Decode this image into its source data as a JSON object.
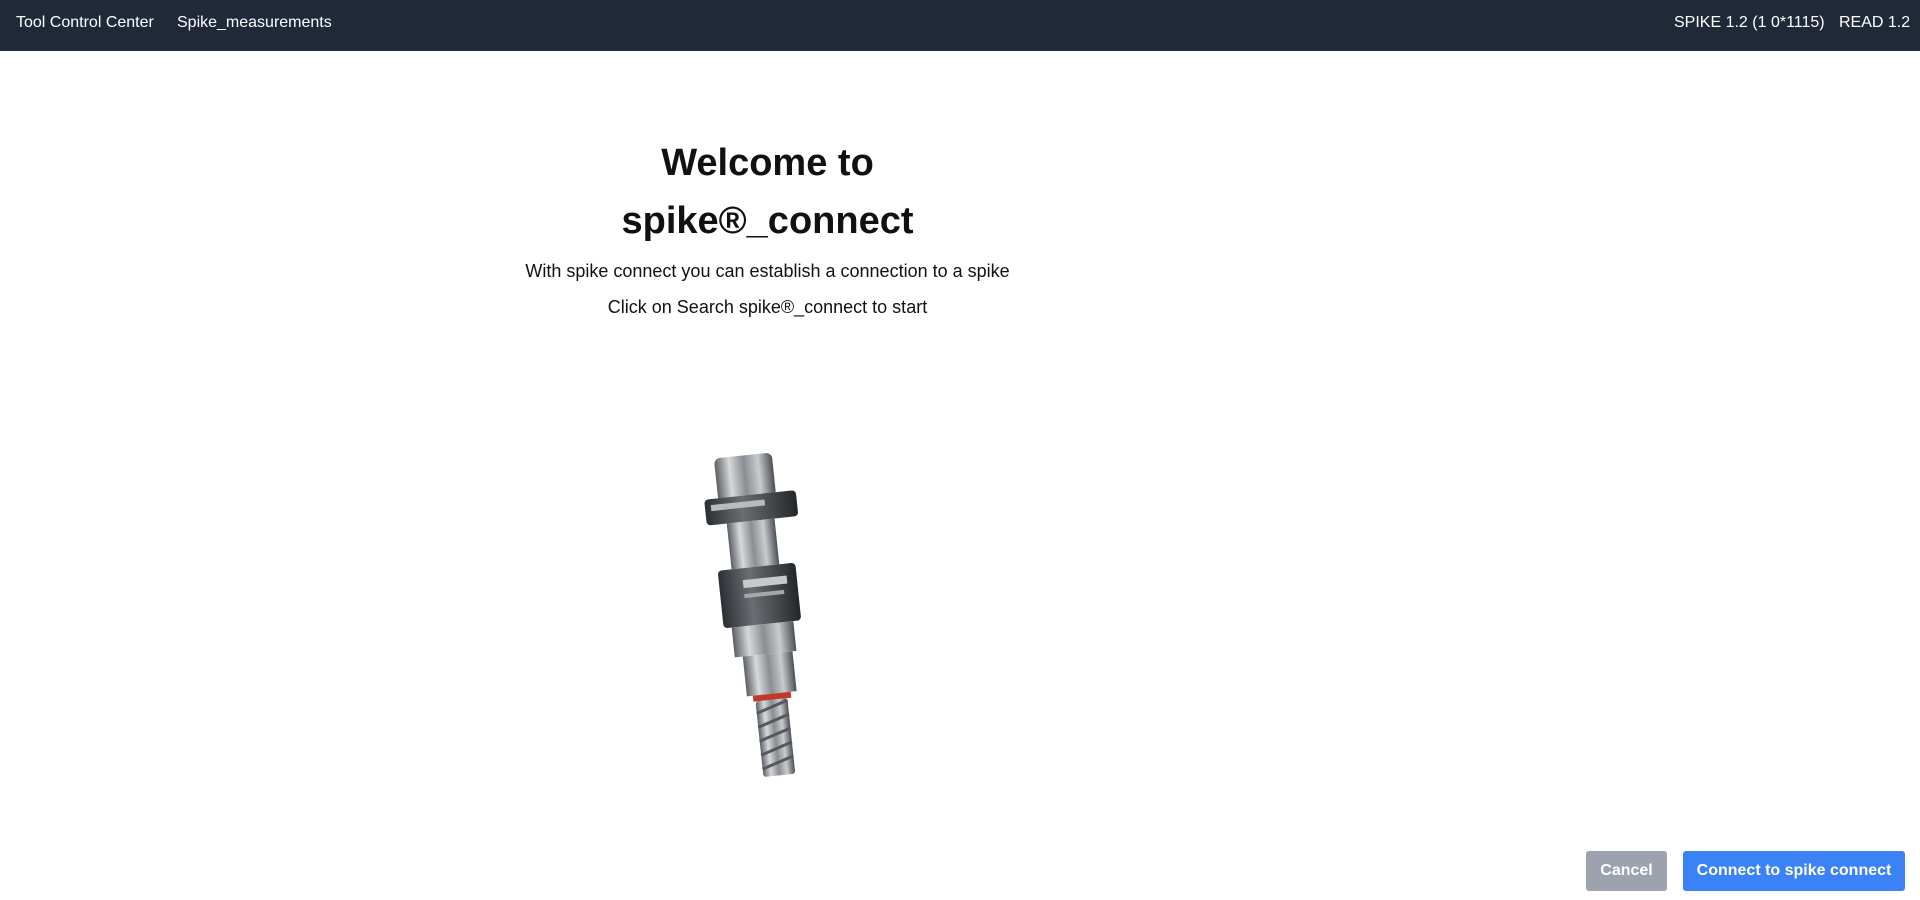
{
  "header": {
    "app_title": "Tool Control Center",
    "nav_link": "Spike_measurements",
    "version_info": "SPIKE 1.2 (1 0*1115)",
    "read_info": "READ 1.2"
  },
  "main": {
    "title": "Welcome to spike®_connect",
    "description": "With spike connect you can establish a connection to a spike",
    "instruction": "Click on Search spike®_connect to start"
  },
  "image": {
    "icon": "spike-tool-holder-image"
  },
  "footer": {
    "cancel_label": "Cancel",
    "connect_label": "Connect to spike connect"
  },
  "colors": {
    "header_bg": "#1f2937",
    "cancel_bg": "#9ca3af",
    "connect_bg": "#3b82f6"
  }
}
